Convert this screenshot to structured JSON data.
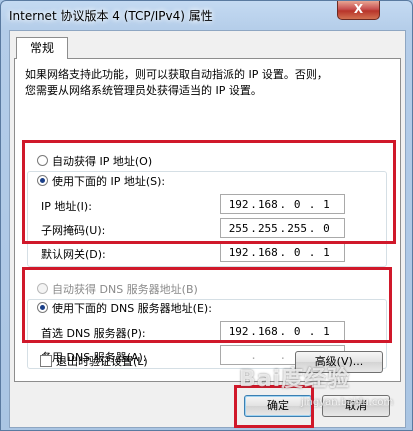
{
  "window": {
    "title": "Internet 协议版本 4 (TCP/IPv4) 属性",
    "close_glyph": "X"
  },
  "tabs": [
    {
      "label": "常规"
    }
  ],
  "description": {
    "line1": "如果网络支持此功能，则可以获取自动指派的 IP 设置。否则，",
    "line2": "您需要从网络系统管理员处获得适当的 IP 设置。"
  },
  "ip_section": {
    "auto_label": "自动获得 IP 地址(O)",
    "manual_label": "使用下面的 IP 地址(S):",
    "selected": "manual",
    "fields": [
      {
        "label": "IP 地址(I):",
        "octets": [
          "192",
          "168",
          "0",
          "1"
        ]
      },
      {
        "label": "子网掩码(U):",
        "octets": [
          "255",
          "255",
          "255",
          "0"
        ]
      },
      {
        "label": "默认网关(D):",
        "octets": [
          "192",
          "168",
          "0",
          "1"
        ]
      }
    ]
  },
  "dns_section": {
    "auto_label": "自动获得 DNS 服务器地址(B)",
    "manual_label": "使用下面的 DNS 服务器地址(E):",
    "selected": "manual",
    "fields": [
      {
        "label": "首选 DNS 服务器(P):",
        "octets": [
          "192",
          "168",
          "0",
          "1"
        ]
      },
      {
        "label": "备用 DNS 服务器(A):",
        "octets": [
          "",
          "",
          "",
          ""
        ]
      }
    ]
  },
  "validate": {
    "label": "退出时验证设置(L)",
    "checked": false
  },
  "buttons": {
    "advanced": "高级(V)...",
    "ok": "确定",
    "cancel": "取消"
  },
  "watermark": {
    "main": "Bai度经验",
    "sub": "jingyan.baidu.com"
  },
  "colors": {
    "highlight": "#d0182a",
    "titlebar": "#b4cde9"
  }
}
